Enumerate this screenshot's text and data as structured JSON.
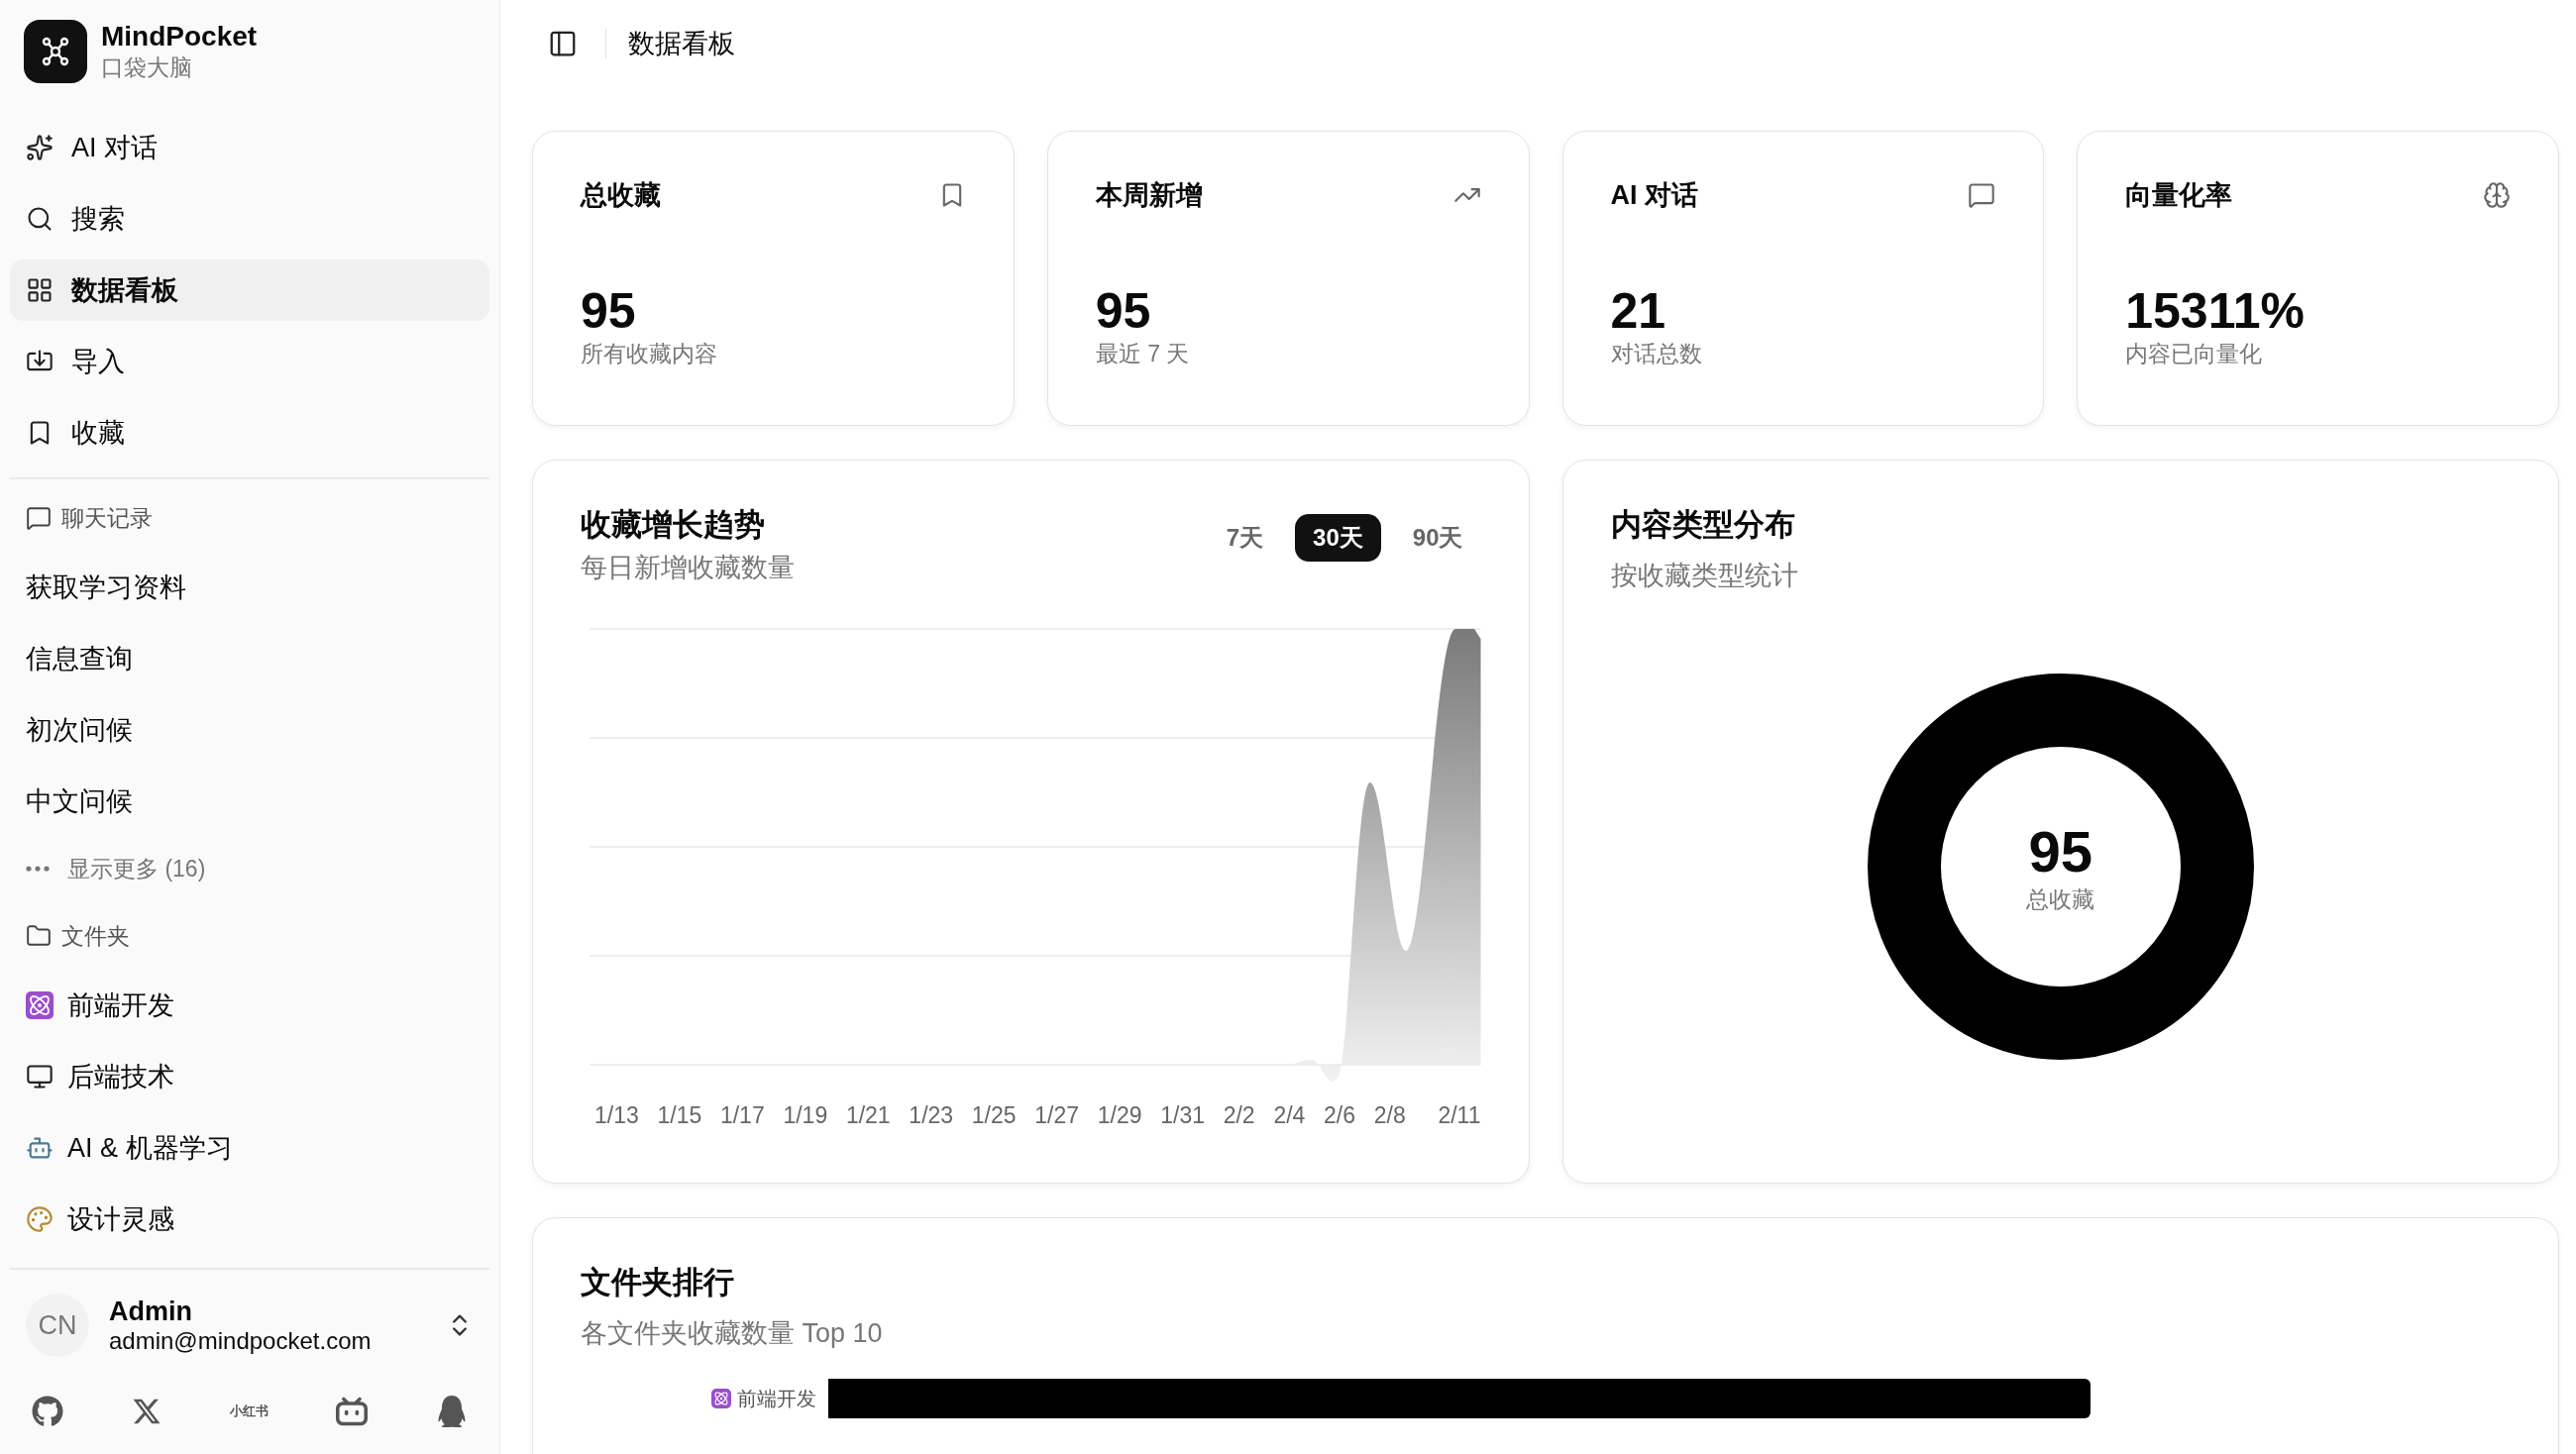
{
  "sidebar": {
    "brand": {
      "name": "MindPocket",
      "subtitle": "口袋大脑"
    },
    "nav": [
      {
        "kind": "sparkles",
        "label": "AI 对话",
        "selected": false
      },
      {
        "kind": "search",
        "label": "搜索",
        "selected": false
      },
      {
        "kind": "grid",
        "label": "数据看板",
        "selected": true
      },
      {
        "kind": "import",
        "label": "导入",
        "selected": false
      },
      {
        "kind": "bookmark",
        "label": "收藏",
        "selected": false
      }
    ],
    "chat_history": {
      "title": "聊天记录",
      "items": [
        "获取学习资料",
        "信息查询",
        "初次问候",
        "中文问候"
      ],
      "show_more": "显示更多 (16)"
    },
    "folders": {
      "title": "文件夹",
      "items": [
        {
          "kind": "atom",
          "label": "前端开发"
        },
        {
          "kind": "monitor",
          "label": "后端技术"
        },
        {
          "kind": "robot",
          "label": "AI & 机器学习"
        },
        {
          "kind": "palette",
          "label": "设计灵感"
        }
      ]
    },
    "user": {
      "avatar": "CN",
      "name": "Admin",
      "email": "admin@mindpocket.com"
    },
    "footer_links": [
      {
        "kind": "github"
      },
      {
        "kind": "x"
      },
      {
        "kind": "text",
        "label": "小红书"
      },
      {
        "kind": "tv"
      },
      {
        "kind": "penguin"
      }
    ]
  },
  "header": {
    "title": "数据看板"
  },
  "stats": [
    {
      "title": "总收藏",
      "kind": "bookmark",
      "value": "95",
      "caption": "所有收藏内容"
    },
    {
      "title": "本周新增",
      "kind": "trend",
      "value": "95",
      "caption": "最近 7 天"
    },
    {
      "title": "AI 对话",
      "kind": "message",
      "value": "21",
      "caption": "对话总数"
    },
    {
      "title": "向量化率",
      "kind": "brain",
      "value": "15311%",
      "caption": "内容已向量化"
    }
  ],
  "trend": {
    "title": "收藏增长趋势",
    "subtitle": "每日新增收藏数量",
    "ranges": [
      {
        "label": "7天",
        "selected": false
      },
      {
        "label": "30天",
        "selected": true
      },
      {
        "label": "90天",
        "selected": false
      }
    ],
    "x_labels": [
      "1/13",
      "1/15",
      "1/17",
      "1/19",
      "1/21",
      "1/23",
      "1/25",
      "1/27",
      "1/29",
      "1/31",
      "2/2",
      "2/4",
      "2/6",
      "2/8",
      "2/11"
    ]
  },
  "distribution": {
    "title": "内容类型分布",
    "subtitle": "按收藏类型统计",
    "total": "95",
    "total_label": "总收藏"
  },
  "ranking": {
    "title": "文件夹排行",
    "subtitle": "各文件夹收藏数量 Top 10",
    "rows": [
      {
        "kind": "atom",
        "label": "前端开发"
      }
    ]
  }
}
